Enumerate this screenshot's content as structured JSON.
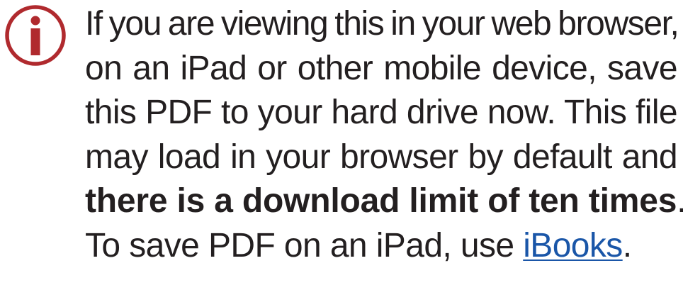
{
  "notice": {
    "icon": "info-icon",
    "icon_color": "#b02a2e",
    "link_color": "#1a56a8",
    "lines": {
      "l1": "If you are viewing this in your web browser,",
      "l2": "on an iPad or other mobile device, save",
      "l3": "this PDF to your hard drive now. This file",
      "l4": "may load in your browser by default and",
      "l5_bold": "there is a download limit of ten times",
      "l5_end": ".",
      "l6_start": "To save PDF on an iPad, use ",
      "l6_link": "iBooks",
      "l6_end": "."
    }
  }
}
